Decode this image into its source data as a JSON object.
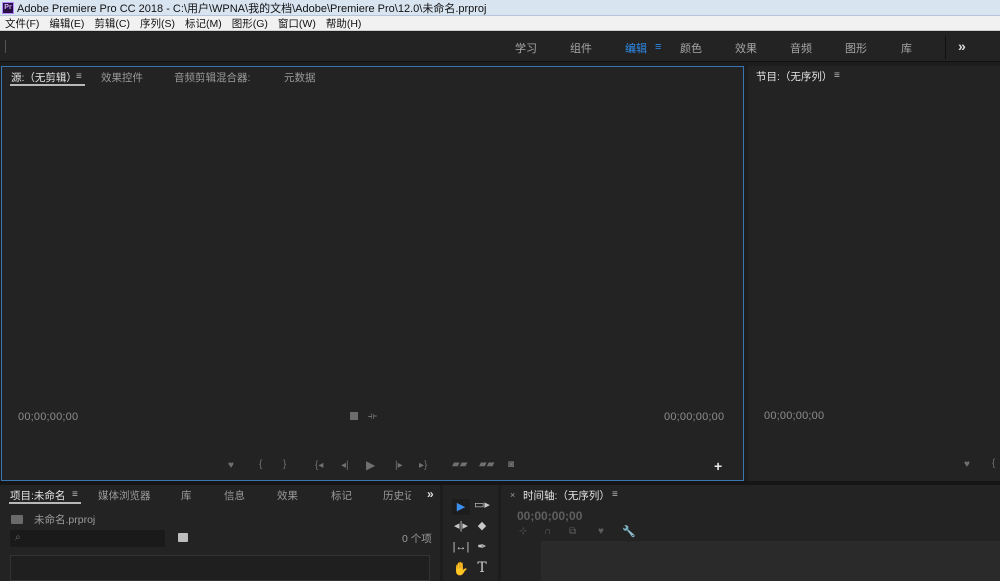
{
  "window": {
    "title": "Adobe Premiere Pro CC 2018 - C:\\用户\\WPNA\\我的文档\\Adobe\\Premiere Pro\\12.0\\未命名.prproj",
    "logo": "Pr"
  },
  "menu": {
    "items": [
      "文件(F)",
      "编辑(E)",
      "剪辑(C)",
      "序列(S)",
      "标记(M)",
      "图形(G)",
      "窗口(W)",
      "帮助(H)"
    ]
  },
  "workspace": {
    "tabs": [
      "学习",
      "组件",
      "编辑",
      "颜色",
      "效果",
      "音频",
      "图形",
      "库"
    ],
    "active": "编辑",
    "menu_icon": "≡",
    "more_icon": "»",
    "accent_color": "#2d8ceb"
  },
  "source_monitor": {
    "tabs": [
      "源:（无剪辑）",
      "效果控件",
      "音频剪辑混合器:",
      "元数据"
    ],
    "menu_icon": "≡",
    "timecode_left": "00;00;00;00",
    "timecode_right": "00;00;00;00",
    "add_button": "+",
    "controls": [
      "marker-icon",
      "mark-in-icon",
      "mark-out-icon",
      "go-to-in-icon",
      "step-back-icon",
      "play-icon",
      "step-forward-icon",
      "go-to-out-icon",
      "insert-icon",
      "overwrite-icon",
      "export-frame-icon"
    ]
  },
  "program_monitor": {
    "title": "节目:（无序列）",
    "menu_icon": "≡",
    "timecode_left": "00;00;00;00"
  },
  "project_panel": {
    "tabs": [
      "项目:未命名",
      "媒体浏览器",
      "库",
      "信息",
      "效果",
      "标记",
      "历史记"
    ],
    "menu_icon": "≡",
    "more_icon": "»",
    "file_name": "未命名.prproj",
    "search_placeholder": "",
    "item_count": "0 个项"
  },
  "tools": [
    "selection-tool",
    "track-select-tool",
    "ripple-edit-tool",
    "razor-tool",
    "slip-tool",
    "pen-tool",
    "hand-tool",
    "type-tool"
  ],
  "timeline": {
    "close_icon": "×",
    "title": "时间轴:（无序列）",
    "menu_icon": "≡",
    "timecode": "00;00;00;00"
  }
}
